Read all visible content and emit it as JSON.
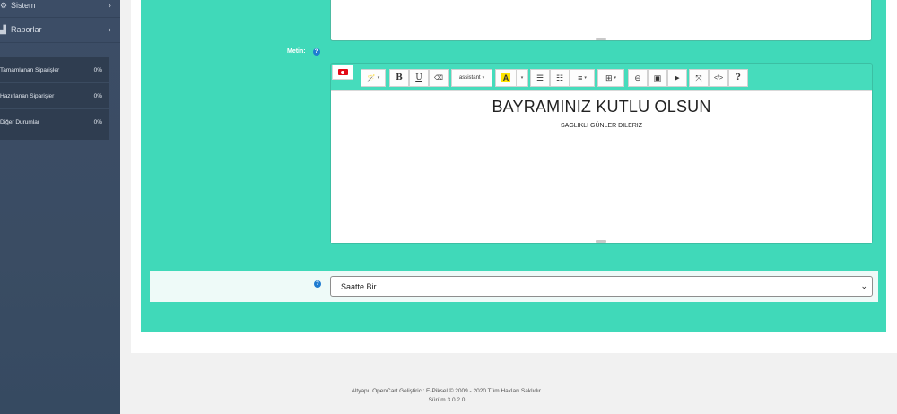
{
  "sidebar": {
    "items": [
      {
        "label": "Sistem",
        "icon": "gear-icon",
        "glyph": "⚙",
        "chevron": "›"
      },
      {
        "label": "Raporlar",
        "icon": "bar-chart-icon",
        "glyph": "▟",
        "chevron": "›"
      }
    ],
    "stats": [
      {
        "label": "Tamamlanan Siparişler",
        "value": "0%"
      },
      {
        "label": "Hazırlanan Siparişler",
        "value": "0%"
      },
      {
        "label": "Diğer Durumlar",
        "value": "0%"
      }
    ]
  },
  "form": {
    "metin_label": "Metin:",
    "help_glyph": "?",
    "select_value": "Saatte Bir",
    "select_arrow": "⌄"
  },
  "toolbar": {
    "magic": "🪄",
    "bold": "B",
    "underline": "U",
    "eraser": "⌫",
    "font_name": "assistant",
    "font_color": "A",
    "caret": "▾",
    "ul": "☰",
    "ol": "☷",
    "align": "≡",
    "table": "⊞",
    "link": "⊖",
    "image": "▣",
    "video": "▶",
    "fullscreen": "⤧",
    "code": "</>",
    "help": "?"
  },
  "editor": {
    "title": "BAYRAMINIZ KUTLU OLSUN",
    "subtitle": "SAGLIKLI GÜNLER DILERIZ"
  },
  "footer": {
    "line1": "Altyapı: OpenCart Geliştirici: E-Piksel © 2009 - 2020 Tüm Hakları Saklıdır.",
    "line2": "Sürüm 3.0.2.0"
  },
  "colors": {
    "sidebar": "#3c4d66",
    "accent": "#40d9b9",
    "help": "#1f7bd1"
  }
}
